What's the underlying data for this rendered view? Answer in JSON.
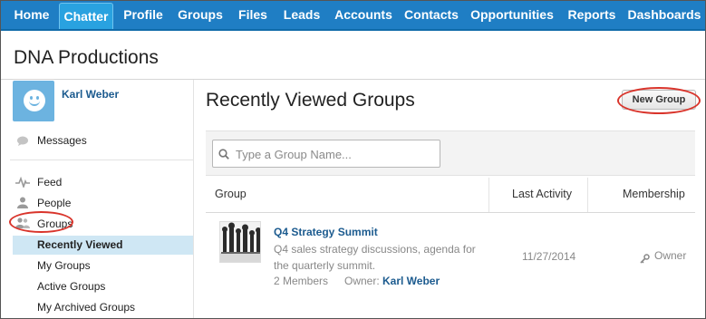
{
  "nav": {
    "tabs": [
      {
        "label": "Home",
        "active": false
      },
      {
        "label": "Chatter",
        "active": true
      },
      {
        "label": "Profile",
        "active": false
      },
      {
        "label": "Groups",
        "active": false
      },
      {
        "label": "Files",
        "active": false
      },
      {
        "label": "Leads",
        "active": false
      },
      {
        "label": "Accounts",
        "active": false
      },
      {
        "label": "Contacts",
        "active": false
      },
      {
        "label": "Opportunities",
        "active": false
      },
      {
        "label": "Reports",
        "active": false
      },
      {
        "label": "Dashboards",
        "active": false
      }
    ]
  },
  "page": {
    "title": "DNA Productions"
  },
  "sidebar": {
    "user_name": "Karl Weber",
    "messages": "Messages",
    "feed": "Feed",
    "people": "People",
    "groups": "Groups",
    "group_sub": [
      "Recently Viewed",
      "My Groups",
      "Active Groups",
      "My Archived Groups"
    ],
    "selected": "Recently Viewed"
  },
  "main": {
    "title": "Recently Viewed Groups",
    "new_group_button": "New Group",
    "search_placeholder": "Type a Group Name...",
    "columns": {
      "group": "Group",
      "last_activity": "Last Activity",
      "membership": "Membership"
    },
    "rows": [
      {
        "name": "Q4 Strategy Summit",
        "description": "Q4 sales strategy discussions, agenda for the quarterly summit.",
        "members": "2 Members",
        "owner_label": "Owner:",
        "owner_name": "Karl Weber",
        "last_activity": "11/27/2014",
        "membership": "Owner"
      }
    ]
  },
  "colors": {
    "nav_bg": "#1f7ec4",
    "active_tab": "#29a2e0",
    "link": "#1c5b8f",
    "highlight": "#cfe7f4",
    "annotation": "#d9342b"
  },
  "icons": {
    "messages": "speech-bubble-icon",
    "feed": "pulse-icon",
    "people": "person-icon",
    "groups": "group-people-icon",
    "search": "magnifier-icon",
    "membership": "key-icon"
  }
}
